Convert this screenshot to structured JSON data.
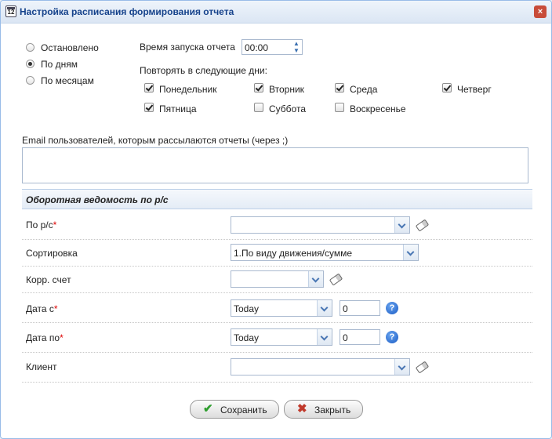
{
  "window": {
    "title": "Настройка расписания формирования отчета",
    "icon_text": "12",
    "close_glyph": "×"
  },
  "mode": {
    "options": [
      {
        "label": "Остановлено",
        "selected": false
      },
      {
        "label": "По дням",
        "selected": true
      },
      {
        "label": "По месяцам",
        "selected": false
      }
    ]
  },
  "time": {
    "label": "Время запуска отчета",
    "value": "00:00"
  },
  "repeat": {
    "label": "Повторять в следующие дни:",
    "days": [
      {
        "label": "Понедельник",
        "checked": true
      },
      {
        "label": "Вторник",
        "checked": true
      },
      {
        "label": "Среда",
        "checked": true
      },
      {
        "label": "Четверг",
        "checked": true
      },
      {
        "label": "Пятница",
        "checked": true
      },
      {
        "label": "Суббота",
        "checked": false
      },
      {
        "label": "Воскресенье",
        "checked": false
      }
    ]
  },
  "email": {
    "label": "Email пользователей, которым рассылаются отчеты (через ;)",
    "value": ""
  },
  "section": {
    "title": "Оборотная ведомость по р/с"
  },
  "fields": {
    "account": {
      "label": "По р/с",
      "required_mark": "*",
      "value": ""
    },
    "sort": {
      "label": "Сортировка",
      "value": "1.По виду движения/сумме"
    },
    "corr": {
      "label": "Корр. счет",
      "value": ""
    },
    "date_from": {
      "label": "Дата с",
      "required_mark": "*",
      "value": "Today",
      "offset": "0"
    },
    "date_to": {
      "label": "Дата по",
      "required_mark": "*",
      "value": "Today",
      "offset": "0"
    },
    "client": {
      "label": "Клиент",
      "value": ""
    }
  },
  "buttons": {
    "save": "Сохранить",
    "close": "Закрыть"
  },
  "colors": {
    "accent": "#15428b",
    "border": "#99bce8",
    "required": "#dd0000",
    "check": "#2e9e2e",
    "cross": "#c0392b"
  }
}
